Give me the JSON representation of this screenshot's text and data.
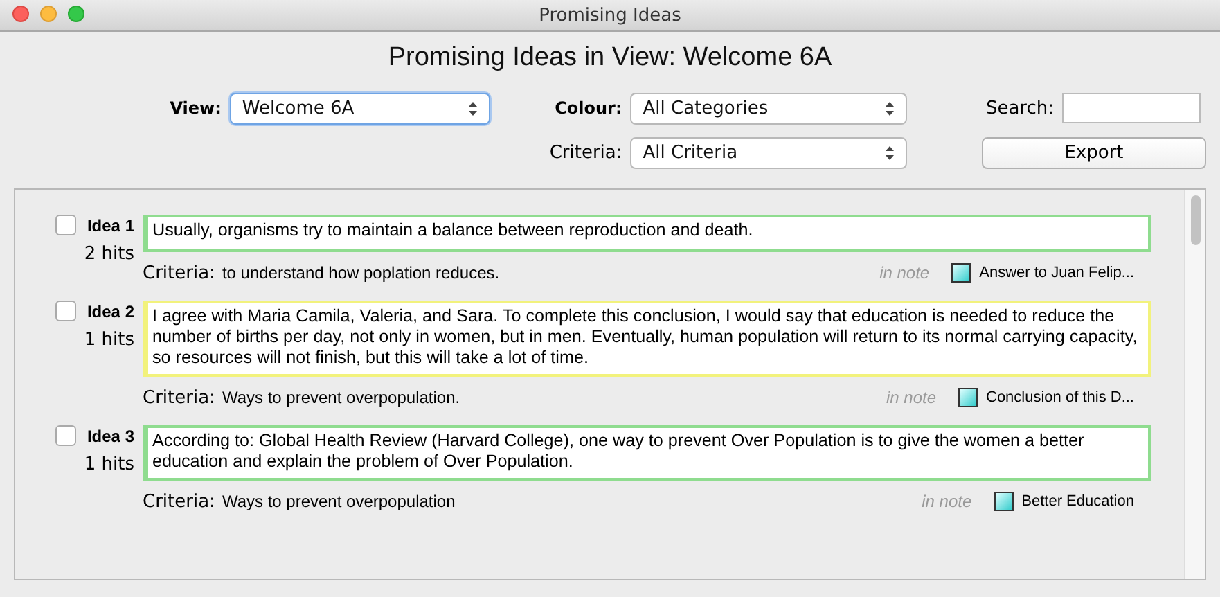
{
  "window": {
    "title": "Promising Ideas"
  },
  "heading": "Promising Ideas in View: Welcome 6A",
  "filters": {
    "view_label": "View:",
    "view": "Welcome 6A",
    "colour_label": "Colour:",
    "colour": "All Categories",
    "search_label": "Search:",
    "criteria_label": "Criteria:",
    "criteria": "All Criteria",
    "export": "Export"
  },
  "ideas": [
    {
      "title": "Idea 1",
      "hits": "2 hits",
      "checked": false,
      "color": "#8fdc8f",
      "text": "Usually, organisms try to maintain a balance between reproduction and death.",
      "criteria_label": "Criteria:",
      "criteria": "to understand how poplation reduces.",
      "note_label": "in note",
      "note": "Answer to Juan Felip..."
    },
    {
      "title": "Idea 2",
      "hits": "1 hits",
      "checked": false,
      "color": "#f2f27c",
      "text": "I agree with Maria Camila, Valeria, and Sara. To complete this conclusion, I would say that education is needed to reduce the number of births per day, not only in women, but in men. Eventually, human population will return to its normal carrying capacity, so resources will not finish, but this will take a lot of time.",
      "criteria_label": "Criteria:",
      "criteria": "Ways to prevent overpopulation.",
      "note_label": "in note",
      "note": "Conclusion of this D..."
    },
    {
      "title": "Idea 3",
      "hits": "1 hits",
      "checked": false,
      "color": "#8fdc8f",
      "text": "According to: Global Health Review (Harvard College), one way to prevent Over Population is to give the women a better education and explain the problem of Over Population.",
      "criteria_label": "Criteria:",
      "criteria": "Ways to prevent overpopulation",
      "note_label": "in note",
      "note": "Better Education"
    }
  ]
}
